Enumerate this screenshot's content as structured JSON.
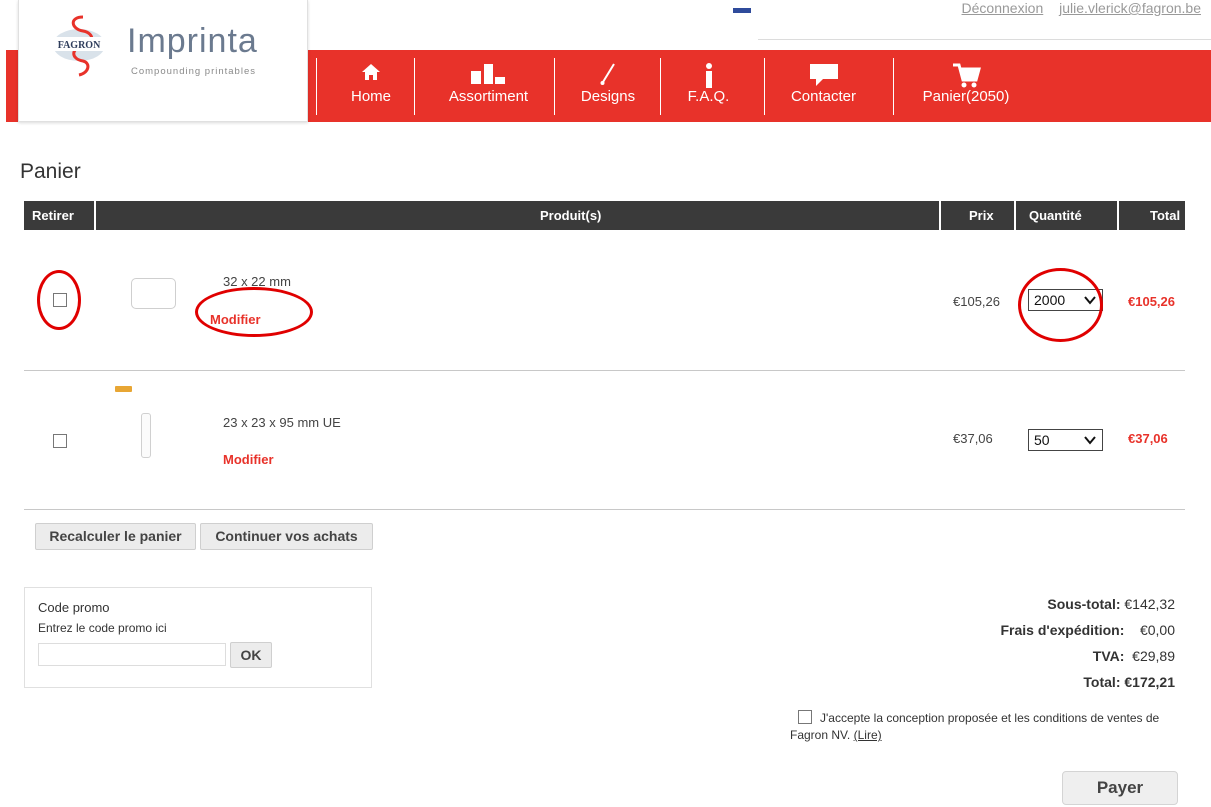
{
  "header": {
    "logout_label": "Déconnexion",
    "user_email": "julie.vlerick@fagron.be"
  },
  "logo": {
    "brand_mark": "FAGRON",
    "wordmark": "Imprinta",
    "tagline": "Compounding printables"
  },
  "nav": {
    "items": [
      {
        "label": "Home",
        "icon": "home-icon"
      },
      {
        "label": "Assortiment",
        "icon": "assortment-icon"
      },
      {
        "label": "Designs",
        "icon": "brush-icon"
      },
      {
        "label": "F.A.Q.",
        "icon": "info-icon"
      },
      {
        "label": "Contacter",
        "icon": "speech-bubble-icon"
      },
      {
        "label": "Panier(2050)",
        "icon": "cart-icon"
      }
    ]
  },
  "page": {
    "title": "Panier"
  },
  "table": {
    "headers": {
      "remove": "Retirer",
      "product": "Produit(s)",
      "price": "Prix",
      "quantity": "Quantité",
      "total": "Total"
    },
    "rows": [
      {
        "name": "32 x 22 mm",
        "modify": "Modifier",
        "price": "€105,26",
        "quantity": "2000",
        "total": "€105,26"
      },
      {
        "name": "23 x 23 x 95 mm UE",
        "modify": "Modifier",
        "price": "€37,06",
        "quantity": "50",
        "total": "€37,06"
      }
    ]
  },
  "actions": {
    "recalculate": "Recalculer le panier",
    "continue": "Continuer vos achats"
  },
  "promo": {
    "title": "Code promo",
    "hint": "Entrez le code promo ici",
    "input_value": "",
    "ok_label": "OK"
  },
  "totals": {
    "subtotal_label": "Sous-total:",
    "subtotal": "€142,32",
    "shipping_label": "Frais d'expédition:",
    "shipping": "€0,00",
    "vat_label": "TVA:",
    "vat": "€29,89",
    "total_label": "Total:",
    "total": "€172,21"
  },
  "terms": {
    "text": "J'accepte la conception proposée et les conditions de ventes de Fagron NV.",
    "link": "(Lire)"
  },
  "pay_label": "Payer",
  "colors": {
    "brand_red": "#e8322a",
    "header_dark": "#3a3a3a",
    "annotation_red": "#e00000"
  }
}
